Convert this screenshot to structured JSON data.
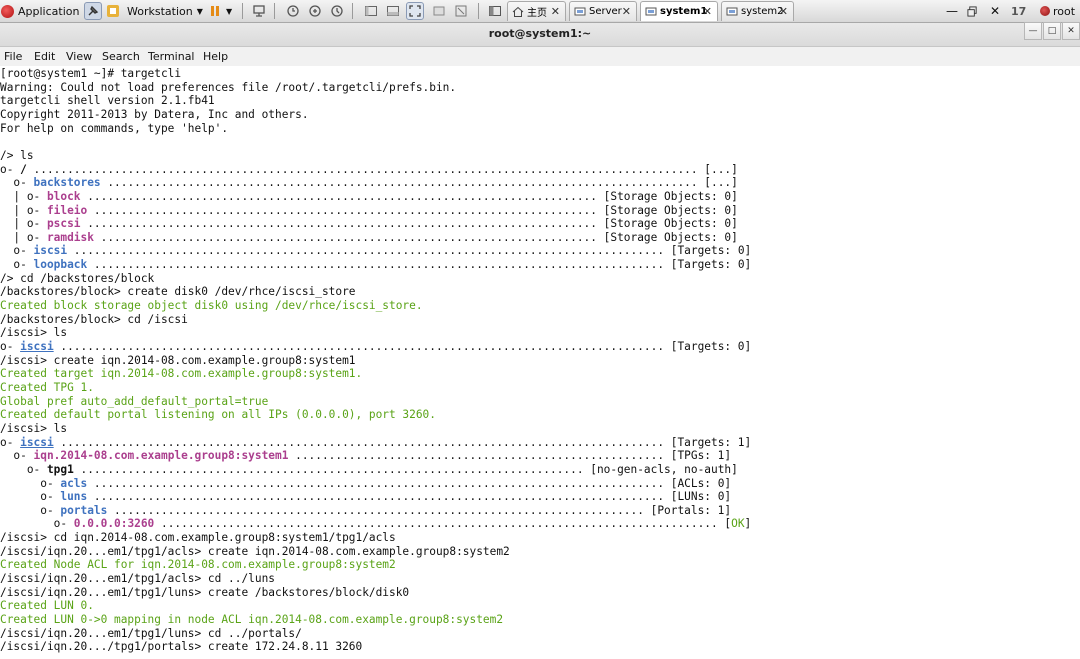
{
  "taskbar": {
    "app_label": "Application",
    "workstation_label": "Workstation",
    "clock": "17",
    "user": "root",
    "tabs": [
      {
        "label": "主页",
        "active": false
      },
      {
        "label": "Server",
        "active": false
      },
      {
        "label": "system1",
        "active": true
      },
      {
        "label": "system2",
        "active": false
      }
    ]
  },
  "window": {
    "title": "root@system1:~",
    "menu": [
      "File",
      "Edit",
      "View",
      "Search",
      "Terminal",
      "Help"
    ]
  },
  "colors": {
    "green": "#5aa317",
    "blue": "#3f72bf",
    "magenta": "#ab3f8e"
  },
  "terminal_lines": [
    [
      {
        "t": "[root@system1 ~]# targetcli"
      }
    ],
    [
      {
        "t": "Warning: Could not load preferences file /root/.targetcli/prefs.bin."
      }
    ],
    [
      {
        "t": "targetcli shell version 2.1.fb41"
      }
    ],
    [
      {
        "t": "Copyright 2011-2013 by Datera, Inc and others."
      }
    ],
    [
      {
        "t": "For help on commands, type 'help'."
      }
    ],
    [
      {
        "t": ""
      }
    ],
    [
      {
        "t": "/> ls"
      }
    ],
    [
      {
        "t": "o- "
      },
      {
        "t": "/",
        "s": "bold"
      },
      {
        "t": " ................................................................................................... [...]"
      }
    ],
    [
      {
        "t": "  o- "
      },
      {
        "t": "backstores",
        "s": "blue"
      },
      {
        "t": " ........................................................................................ [...]"
      }
    ],
    [
      {
        "t": "  | o- "
      },
      {
        "t": "block",
        "s": "mag"
      },
      {
        "t": " ............................................................................ [Storage Objects: 0]"
      }
    ],
    [
      {
        "t": "  | o- "
      },
      {
        "t": "fileio",
        "s": "mag"
      },
      {
        "t": " ........................................................................... [Storage Objects: 0]"
      }
    ],
    [
      {
        "t": "  | o- "
      },
      {
        "t": "pscsi",
        "s": "mag"
      },
      {
        "t": " ............................................................................ [Storage Objects: 0]"
      }
    ],
    [
      {
        "t": "  | o- "
      },
      {
        "t": "ramdisk",
        "s": "mag"
      },
      {
        "t": " .......................................................................... [Storage Objects: 0]"
      }
    ],
    [
      {
        "t": "  o- "
      },
      {
        "t": "iscsi",
        "s": "blue"
      },
      {
        "t": " ........................................................................................ [Targets: 0]"
      }
    ],
    [
      {
        "t": "  o- "
      },
      {
        "t": "loopback",
        "s": "blue"
      },
      {
        "t": " ..................................................................................... [Targets: 0]"
      }
    ],
    [
      {
        "t": "/> cd /backstores/block"
      }
    ],
    [
      {
        "t": "/backstores/block> create disk0 /dev/rhce/iscsi_store"
      }
    ],
    [
      {
        "t": "Created block storage object disk0 using /dev/rhce/iscsi_store.",
        "s": "green"
      }
    ],
    [
      {
        "t": "/backstores/block> cd /iscsi"
      }
    ],
    [
      {
        "t": "/iscsi> ls"
      }
    ],
    [
      {
        "t": "o- "
      },
      {
        "t": "iscsi",
        "s": "blue-ul"
      },
      {
        "t": " .......................................................................................... [Targets: 0]"
      }
    ],
    [
      {
        "t": "/iscsi> create iqn.2014-08.com.example.group8:system1"
      }
    ],
    [
      {
        "t": "Created target iqn.2014-08.com.example.group8:system1.",
        "s": "green"
      }
    ],
    [
      {
        "t": "Created TPG 1.",
        "s": "green"
      }
    ],
    [
      {
        "t": "Global pref auto_add_default_portal=true",
        "s": "green"
      }
    ],
    [
      {
        "t": "Created default portal listening on all IPs (0.0.0.0), port 3260.",
        "s": "green"
      }
    ],
    [
      {
        "t": "/iscsi> ls"
      }
    ],
    [
      {
        "t": "o- "
      },
      {
        "t": "iscsi",
        "s": "blue-ul"
      },
      {
        "t": " .......................................................................................... [Targets: 1]"
      }
    ],
    [
      {
        "t": "  o- "
      },
      {
        "t": "iqn.2014-08.com.example.group8:system1",
        "s": "mag"
      },
      {
        "t": " ....................................................... [TPGs: 1]"
      }
    ],
    [
      {
        "t": "    o- "
      },
      {
        "t": "tpg1",
        "s": "bold"
      },
      {
        "t": " ........................................................................... [no-gen-acls, no-auth]"
      }
    ],
    [
      {
        "t": "      o- "
      },
      {
        "t": "acls",
        "s": "blue"
      },
      {
        "t": " ..................................................................................... [ACLs: 0]"
      }
    ],
    [
      {
        "t": "      o- "
      },
      {
        "t": "luns",
        "s": "blue"
      },
      {
        "t": " ..................................................................................... [LUNs: 0]"
      }
    ],
    [
      {
        "t": "      o- "
      },
      {
        "t": "portals",
        "s": "blue"
      },
      {
        "t": " ............................................................................... [Portals: 1]"
      }
    ],
    [
      {
        "t": "        o- "
      },
      {
        "t": "0.0.0.0:3260",
        "s": "mag"
      },
      {
        "t": " ................................................................................... ["
      },
      {
        "t": "OK",
        "s": "green"
      },
      {
        "t": "]"
      }
    ],
    [
      {
        "t": "/iscsi> cd iqn.2014-08.com.example.group8:system1/tpg1/acls"
      }
    ],
    [
      {
        "t": "/iscsi/iqn.20...em1/tpg1/acls> create iqn.2014-08.com.example.group8:system2"
      }
    ],
    [
      {
        "t": "Created Node ACL for iqn.2014-08.com.example.group8:system2",
        "s": "green"
      }
    ],
    [
      {
        "t": "/iscsi/iqn.20...em1/tpg1/acls> cd ../luns"
      }
    ],
    [
      {
        "t": "/iscsi/iqn.20...em1/tpg1/luns> create /backstores/block/disk0"
      }
    ],
    [
      {
        "t": "Created LUN 0.",
        "s": "green"
      }
    ],
    [
      {
        "t": "Created LUN 0->0 mapping in node ACL iqn.2014-08.com.example.group8:system2",
        "s": "green"
      }
    ],
    [
      {
        "t": "/iscsi/iqn.20...em1/tpg1/luns> cd ../portals/"
      }
    ],
    [
      {
        "t": "/iscsi/iqn.20.../tpg1/portals> create 172.24.8.11 3260"
      }
    ]
  ]
}
